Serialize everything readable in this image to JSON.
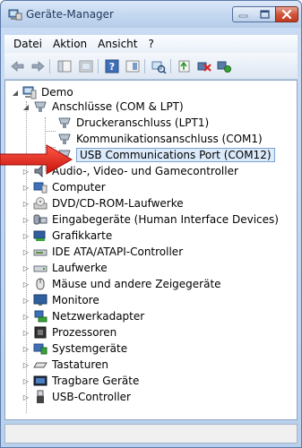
{
  "window": {
    "title": "Geräte-Manager"
  },
  "menu": {
    "items": [
      "Datei",
      "Aktion",
      "Ansicht",
      "?"
    ]
  },
  "tree": {
    "root": {
      "label": "Demo",
      "icon": "computer-icon"
    },
    "nodes": [
      {
        "label": "Anschlüsse (COM & LPT)",
        "icon": "port-icon",
        "expanded": true
      },
      {
        "label": "Druckeranschluss (LPT1)",
        "icon": "port-icon"
      },
      {
        "label": "Kommunikationsanschluss (COM1)",
        "icon": "port-icon"
      },
      {
        "label": "USB Communications Port (COM12)",
        "icon": "port-icon",
        "selected": true
      },
      {
        "label": "Audio-, Video- und Gamecontroller",
        "icon": "speaker-icon"
      },
      {
        "label": "Computer",
        "icon": "computer-icon"
      },
      {
        "label": "DVD/CD-ROM-Laufwerke",
        "icon": "disc-drive-icon"
      },
      {
        "label": "Eingabegeräte (Human Interface Devices)",
        "icon": "hid-icon"
      },
      {
        "label": "Grafikkarte",
        "icon": "display-adapter-icon"
      },
      {
        "label": "IDE ATA/ATAPI-Controller",
        "icon": "ide-controller-icon"
      },
      {
        "label": "Laufwerke",
        "icon": "hard-drive-icon"
      },
      {
        "label": "Mäuse und andere Zeigegeräte",
        "icon": "mouse-icon"
      },
      {
        "label": "Monitore",
        "icon": "monitor-icon"
      },
      {
        "label": "Netzwerkadapter",
        "icon": "network-adapter-icon"
      },
      {
        "label": "Prozessoren",
        "icon": "processor-icon"
      },
      {
        "label": "Systemgeräte",
        "icon": "system-device-icon"
      },
      {
        "label": "Tastaturen",
        "icon": "keyboard-icon"
      },
      {
        "label": "Tragbare Geräte",
        "icon": "portable-device-icon"
      },
      {
        "label": "USB-Controller",
        "icon": "usb-icon"
      }
    ]
  },
  "colors": {
    "arrow": "#e02020",
    "selection": "#dcebfc"
  }
}
